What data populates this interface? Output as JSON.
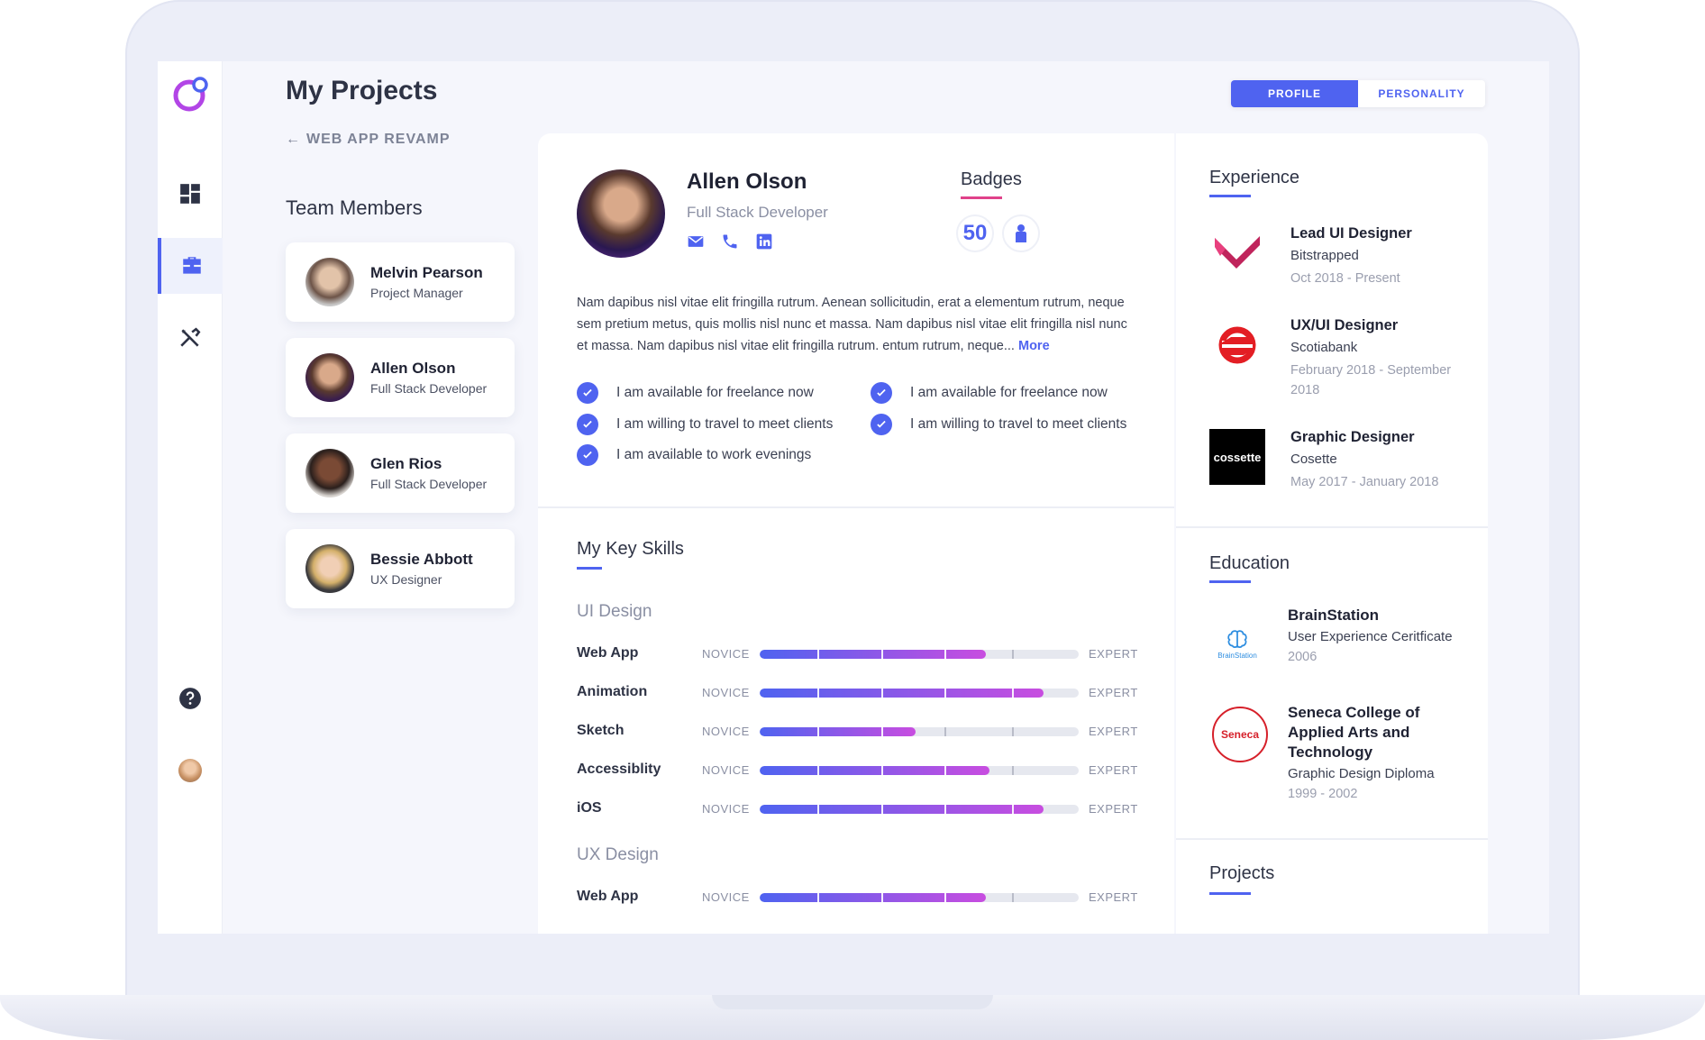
{
  "page": {
    "title": "My Projects",
    "back_label": "WEB APP REVAMP"
  },
  "toggle": {
    "profile": "PROFILE",
    "personality": "PERSONALITY",
    "active": "profile"
  },
  "team": {
    "title": "Team Members",
    "members": [
      {
        "name": "Melvin Pearson",
        "role": "Project Manager"
      },
      {
        "name": "Allen Olson",
        "role": "Full Stack Developer"
      },
      {
        "name": "Glen Rios",
        "role": "Full Stack Developer"
      },
      {
        "name": "Bessie Abbott",
        "role": "UX Designer"
      }
    ]
  },
  "profile": {
    "name": "Allen Olson",
    "role": "Full Stack Developer",
    "badges_title": "Badges",
    "badge_count": "50",
    "bio": "Nam dapibus nisl vitae elit fringilla rutrum. Aenean sollicitudin, erat a elementum rutrum, neque sem pretium metus, quis mollis nisl nunc et massa. Nam dapibus nisl vitae elit fringilla nisl nunc et massa. Nam dapibus nisl vitae elit fringilla rutrum. entum rutrum, neque...",
    "more_label": "More",
    "checks": [
      "I am available for freelance now",
      "I am willing to travel to meet clients",
      "I am available to work evenings",
      "I am available for freelance now",
      "I am willing to travel to meet clients"
    ]
  },
  "skills": {
    "title": "My Key Skills",
    "novice_label": "NOVICE",
    "expert_label": "EXPERT",
    "groups": [
      {
        "name": "UI Design",
        "items": [
          {
            "name": "Web App",
            "level": 0.71
          },
          {
            "name": "Animation",
            "level": 0.89
          },
          {
            "name": "Sketch",
            "level": 0.49
          },
          {
            "name": "Accessiblity",
            "level": 0.72
          },
          {
            "name": "iOS",
            "level": 0.89
          }
        ]
      },
      {
        "name": "UX Design",
        "items": [
          {
            "name": "Web App",
            "level": 0.71
          }
        ]
      }
    ]
  },
  "experience": {
    "title": "Experience",
    "items": [
      {
        "title": "Lead UI Designer",
        "company": "Bitstrapped",
        "dates": "Oct 2018 - Present"
      },
      {
        "title": "UX/UI Designer",
        "company": "Scotiabank",
        "dates": "February 2018 - September 2018"
      },
      {
        "title": "Graphic Designer",
        "company": "Cosette",
        "dates": "May 2017 - January 2018",
        "logo_text": "cossette"
      }
    ]
  },
  "education": {
    "title": "Education",
    "items": [
      {
        "title": "BrainStation",
        "detail": "User Experience Ceritficate",
        "dates": "2006",
        "logo_text": "BrainStation"
      },
      {
        "title": "Seneca College of Applied Arts and Technology",
        "detail": "Graphic Design Diploma",
        "dates": "1999 - 2002",
        "logo_text": "Seneca"
      }
    ]
  },
  "projects": {
    "title": "Projects"
  },
  "colors": {
    "accent": "#4f63f0",
    "badge_underline": "#e0428a",
    "bar_end": "#c84de0"
  }
}
